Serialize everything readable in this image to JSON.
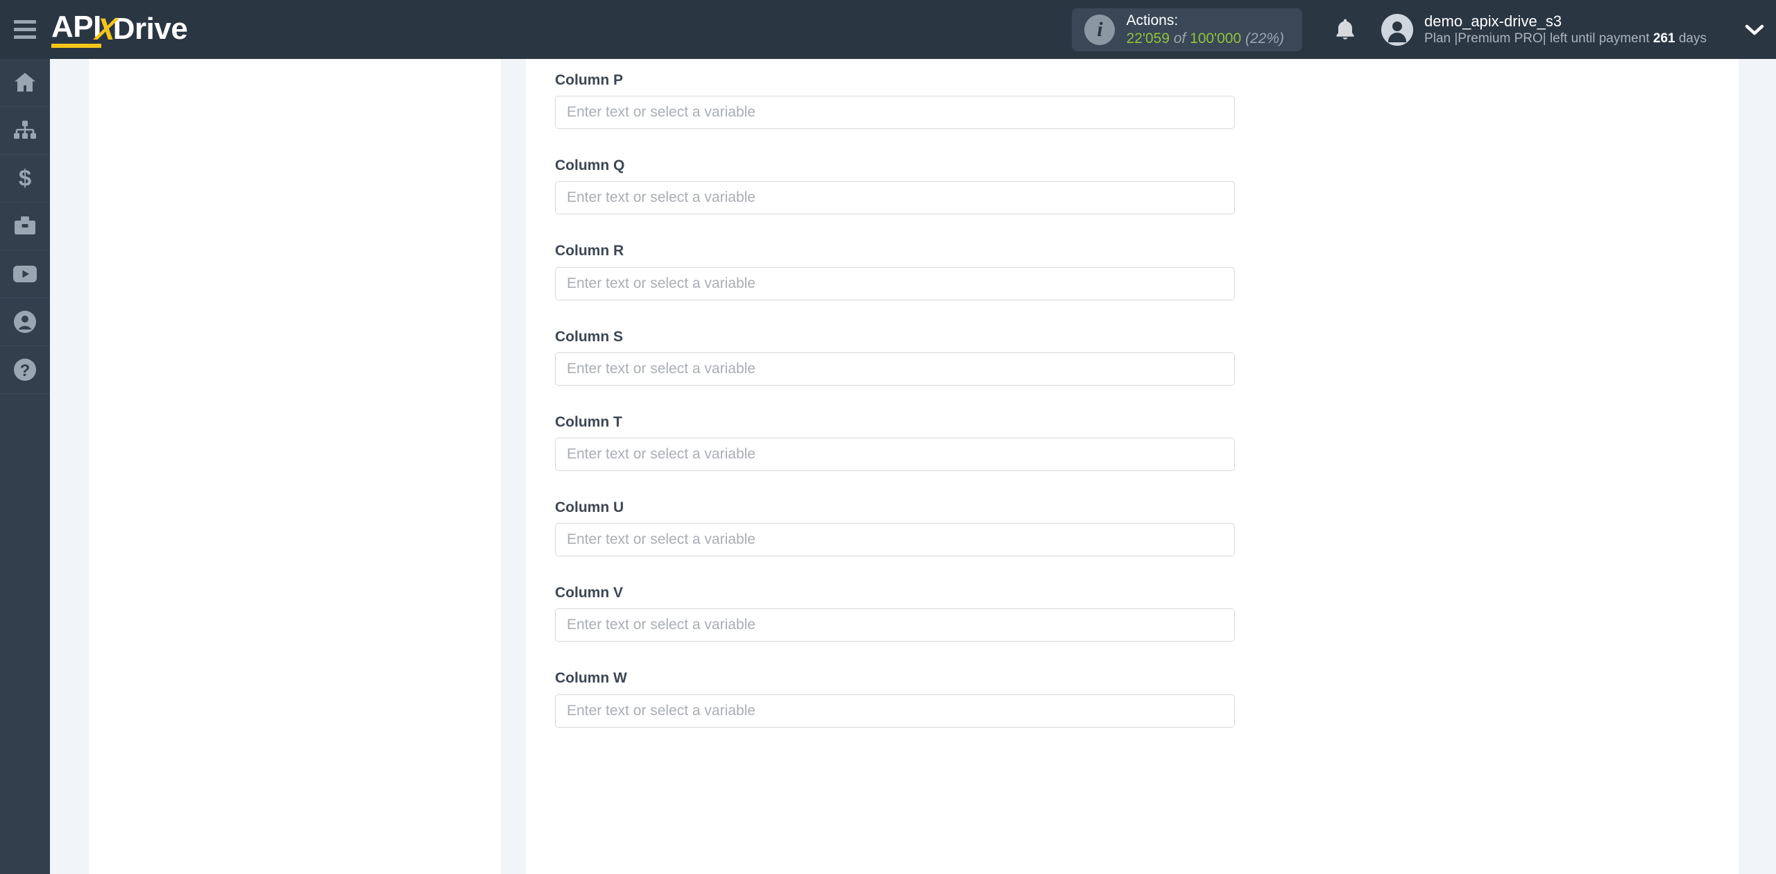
{
  "header": {
    "menu_icon": "hamburger-menu-icon",
    "logo": {
      "part1": "API",
      "part2": "X",
      "part3": "Drive"
    },
    "actions": {
      "icon": "info-icon",
      "title": "Actions:",
      "used": "22'059",
      "of": "of",
      "total": "100'000",
      "percent": "(22%)"
    },
    "notifications_icon": "bell-icon",
    "account": {
      "avatar_icon": "user-avatar-icon",
      "username": "demo_apix-drive_s3",
      "plan_prefix": "Plan |Premium PRO| left until payment ",
      "plan_days": "261",
      "plan_suffix": " days",
      "dropdown_icon": "chevron-down-icon"
    }
  },
  "sidebar": {
    "items": [
      {
        "name": "sidebar-item-home",
        "icon": "home-icon"
      },
      {
        "name": "sidebar-item-connections",
        "icon": "sitemap-icon"
      },
      {
        "name": "sidebar-item-billing",
        "icon": "dollar-icon"
      },
      {
        "name": "sidebar-item-business",
        "icon": "briefcase-icon"
      },
      {
        "name": "sidebar-item-videos",
        "icon": "youtube-icon"
      },
      {
        "name": "sidebar-item-account",
        "icon": "user-circle-icon"
      },
      {
        "name": "sidebar-item-help",
        "icon": "question-circle-icon"
      }
    ]
  },
  "form": {
    "placeholder": "Enter text or select a variable",
    "fields": [
      {
        "label": "Column P",
        "value": ""
      },
      {
        "label": "Column Q",
        "value": ""
      },
      {
        "label": "Column R",
        "value": ""
      },
      {
        "label": "Column S",
        "value": ""
      },
      {
        "label": "Column T",
        "value": ""
      },
      {
        "label": "Column U",
        "value": ""
      },
      {
        "label": "Column V",
        "value": ""
      },
      {
        "label": "Column W",
        "value": ""
      }
    ]
  },
  "colors": {
    "header_bg": "#2b3643",
    "sidebar_bg": "#323f4d",
    "accent_yellow": "#f5c518",
    "counter_green": "#93c13f",
    "page_bg": "#f1f5f9",
    "label": "#3c4753",
    "placeholder": "#a9aeb4",
    "input_border": "#d9d9d9"
  }
}
